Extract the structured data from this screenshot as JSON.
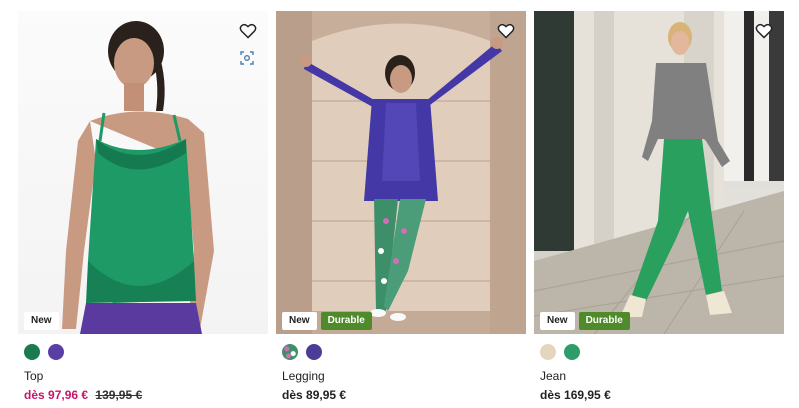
{
  "products": [
    {
      "name": "Top",
      "price_prefix": "dès",
      "price": "97,96 €",
      "old_price": "139,95 €",
      "badges": [
        "New"
      ],
      "swatches": [
        "#1b7a51",
        "#5a3ea3"
      ]
    },
    {
      "name": "Legging",
      "price_prefix": "dès",
      "price": "89,95 €",
      "old_price": "",
      "badges": [
        "New",
        "Durable"
      ],
      "swatches": [
        "pattern",
        "#4b3d95"
      ]
    },
    {
      "name": "Jean",
      "price_prefix": "dès",
      "price": "169,95 €",
      "old_price": "",
      "badges": [
        "New",
        "Durable"
      ],
      "swatches": [
        "#e4d5bd",
        "#2e9d69"
      ]
    }
  ],
  "colors": {
    "sale": "#c5166c",
    "durable_badge": "#4f8a2b"
  },
  "icons": [
    "heart-icon",
    "visual-search-icon"
  ]
}
